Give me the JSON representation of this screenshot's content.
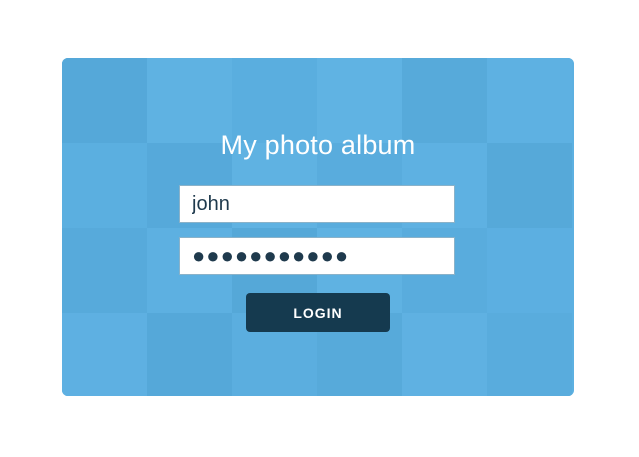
{
  "app": {
    "title": "My photo album"
  },
  "login_form": {
    "username_value": "john",
    "password_value": "●●●●●●●●●●●",
    "login_label": "LOGIN"
  },
  "colors": {
    "card_background": "#5aaede",
    "button_background": "#153a4f",
    "text_light": "#ffffff",
    "input_text": "#1f3a4d"
  }
}
